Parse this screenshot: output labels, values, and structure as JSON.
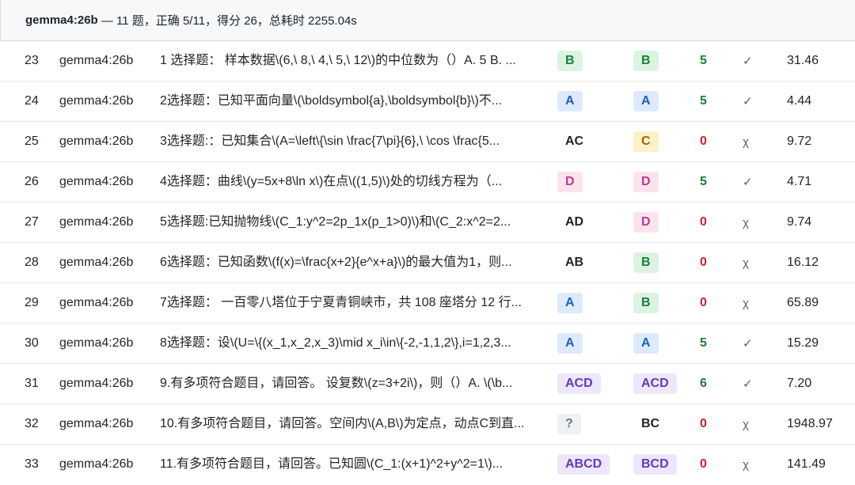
{
  "header": {
    "model": "gemma4:26b",
    "summary": " — 11 题，正确 5/11，得分 26，总耗时 2255.04s"
  },
  "colors": {
    "A": {
      "bg": "#ddeafc",
      "fg": "#1f5fbf"
    },
    "B": {
      "bg": "#dcf3e2",
      "fg": "#1a7f37"
    },
    "C": {
      "bg": "#fdf1c7",
      "fg": "#9a6700"
    },
    "D": {
      "bg": "#fbe3ee",
      "fg": "#bf3989"
    },
    "MULTI": {
      "bg": "#ece7fb",
      "fg": "#6639ba"
    },
    "Q": {
      "bg": "#eef1f4",
      "fg": "#6e7781"
    }
  },
  "rows": [
    {
      "id": "23",
      "model": "gemma4:26b",
      "question": "1 选择题： 样本数据\\(6,\\ 8,\\ 4,\\ 5,\\ 12\\)的中位数为（）A. 5 B. ...",
      "pred": "B",
      "pred_style": "B",
      "gold": "B",
      "gold_style": "B",
      "score": "5",
      "mark": "✓",
      "time": "31.46"
    },
    {
      "id": "24",
      "model": "gemma4:26b",
      "question": "2选择题：已知平面向量\\(\\boldsymbol{a},\\boldsymbol{b}\\)不...",
      "pred": "A",
      "pred_style": "A",
      "gold": "A",
      "gold_style": "A",
      "score": "5",
      "mark": "✓",
      "time": "4.44"
    },
    {
      "id": "25",
      "model": "gemma4:26b",
      "question": "3选择题:：已知集合\\(A=\\left\\{\\sin \\frac{7\\pi}{6},\\ \\cos \\frac{5...",
      "pred": "AC",
      "pred_style": "plain",
      "gold": "C",
      "gold_style": "C",
      "score": "0",
      "mark": "χ",
      "time": "9.72"
    },
    {
      "id": "26",
      "model": "gemma4:26b",
      "question": "4选择题：曲线\\(y=5x+8\\ln x\\)在点\\((1,5)\\)处的切线方程为（...",
      "pred": "D",
      "pred_style": "D",
      "gold": "D",
      "gold_style": "D",
      "score": "5",
      "mark": "✓",
      "time": "4.71"
    },
    {
      "id": "27",
      "model": "gemma4:26b",
      "question": "5选择题:已知抛物线\\(C_1:y^2=2p_1x(p_1>0)\\)和\\(C_2:x^2=2...",
      "pred": "AD",
      "pred_style": "plain",
      "gold": "D",
      "gold_style": "D",
      "score": "0",
      "mark": "χ",
      "time": "9.74"
    },
    {
      "id": "28",
      "model": "gemma4:26b",
      "question": "6选择题：已知函数\\(f(x)=\\frac{x+2}{e^x+a}\\)的最大值为1，则...",
      "pred": "AB",
      "pred_style": "plain",
      "gold": "B",
      "gold_style": "B",
      "score": "0",
      "mark": "χ",
      "time": "16.12"
    },
    {
      "id": "29",
      "model": "gemma4:26b",
      "question": "7选择题： 一百零八塔位于宁夏青铜峡市，共 108 座塔分 12 行...",
      "pred": "A",
      "pred_style": "A",
      "gold": "B",
      "gold_style": "B",
      "score": "0",
      "mark": "χ",
      "time": "65.89"
    },
    {
      "id": "30",
      "model": "gemma4:26b",
      "question": "8选择题：设\\(U=\\{(x_1,x_2,x_3)\\mid x_i\\in\\{-2,-1,1,2\\},i=1,2,3...",
      "pred": "A",
      "pred_style": "A",
      "gold": "A",
      "gold_style": "A",
      "score": "5",
      "mark": "✓",
      "time": "15.29"
    },
    {
      "id": "31",
      "model": "gemma4:26b",
      "question": "9.有多项符合题目，请回答。 设复数\\(z=3+2i\\)，则（）A. \\(\\b...",
      "pred": "ACD",
      "pred_style": "MULTI",
      "gold": "ACD",
      "gold_style": "MULTI",
      "score": "6",
      "mark": "✓",
      "time": "7.20"
    },
    {
      "id": "32",
      "model": "gemma4:26b",
      "question": "10.有多项符合题目，请回答。空间内\\(A,B\\)为定点，动点C到直...",
      "pred": "?",
      "pred_style": "Q",
      "gold": "BC",
      "gold_style": "plain",
      "score": "0",
      "mark": "χ",
      "time": "1948.97"
    },
    {
      "id": "33",
      "model": "gemma4:26b",
      "question": "11.有多项符合题目，请回答。已知圆\\(C_1:(x+1)^2+y^2=1\\)...",
      "pred": "ABCD",
      "pred_style": "MULTI",
      "gold": "BCD",
      "gold_style": "MULTI",
      "score": "0",
      "mark": "χ",
      "time": "141.49"
    }
  ]
}
